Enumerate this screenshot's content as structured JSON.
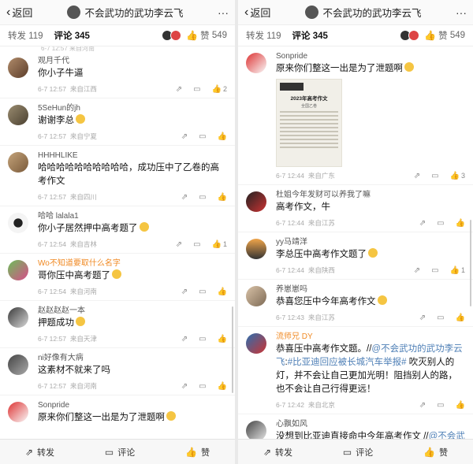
{
  "left": {
    "header": {
      "back_label": "返回",
      "title": "不会武功的武功李云飞",
      "more": "···"
    },
    "tabs": {
      "repost": "转发 119",
      "comment": "评论 345",
      "like_count": "549",
      "like_label": "赞"
    },
    "comments": [
      {
        "name": "观月千代",
        "text": "你小子牛逼",
        "time": "6-7 12:57",
        "source": "来自江西",
        "likes": "2",
        "emoji": false
      },
      {
        "name": "5SeHun的jh",
        "text": "谢谢李总",
        "time": "6-7 12:57",
        "source": "来自宁夏",
        "likes": "",
        "emoji": true
      },
      {
        "name": "HHHHLIKE",
        "text": "哈哈哈哈哈哈哈哈哈哈，成功压中了乙卷的高考作文",
        "time": "6-7 12:57",
        "source": "来自四川",
        "likes": "",
        "emoji": false
      },
      {
        "name": "哈哈 lalala1",
        "text": "你小子居然押中高考题了",
        "time": "6-7 12:54",
        "source": "来自吉林",
        "likes": "1",
        "emoji": true
      },
      {
        "name": "Wo不知道要取什么名字",
        "text": "哥你压中高考题了",
        "time": "6-7 12:54",
        "source": "来自河南",
        "likes": "",
        "emoji": true,
        "orange": true
      },
      {
        "name": "赵赵赵赵一本",
        "text": "押题成功",
        "time": "6-7 12:57",
        "source": "来自天津",
        "likes": "",
        "emoji": true
      },
      {
        "name": "ni好像有大病",
        "text": "这素材不就来了吗",
        "time": "6-7 12:57",
        "source": "来自河南",
        "likes": "",
        "emoji": false
      },
      {
        "name": "Sonpride",
        "text": "原来你们整这一出是为了泄题啊",
        "time": "",
        "source": "",
        "likes": "",
        "emoji": true
      }
    ],
    "bottom": {
      "repost": "转发",
      "comment": "评论",
      "like": "赞"
    }
  },
  "right": {
    "header": {
      "back_label": "返回",
      "title": "不会武功的武功李云飞",
      "more": "···"
    },
    "tabs": {
      "repost": "转发 119",
      "comment": "评论 345",
      "like_count": "549",
      "like_label": "赞"
    },
    "image": {
      "title": "2023年高考作文",
      "subtitle": "全国乙卷"
    },
    "comments": [
      {
        "name": "Sonpride",
        "text": "原来你们整这一出是为了泄题啊",
        "time": "6-7 12:44",
        "source": "来自广东",
        "likes": "3",
        "emoji": true,
        "has_image": true
      },
      {
        "name": "杜姐今年发财可以养我了嘛",
        "text": "高考作文，牛",
        "time": "6-7 12:44",
        "source": "来自江苏",
        "likes": "",
        "emoji": false
      },
      {
        "name": "yy马靖洋",
        "text": "李总压中高考作文题了",
        "time": "6-7 12:44",
        "source": "来自陕西",
        "likes": "1",
        "emoji": true
      },
      {
        "name": "养崽崽吗",
        "text": "恭喜您压中今年高考作文",
        "time": "6-7 12:43",
        "source": "来自江苏",
        "likes": "",
        "emoji": true
      },
      {
        "name": "流师兄 DY",
        "text_before": "恭喜压中高考作文题。//",
        "link1": "@不会武功的武功李云飞",
        "mid1": ":",
        "link2": "#比亚迪回应被长城汽车举报#",
        "text_after": " 吹灭别人的灯，并不会让自己更加光明！阻挡别人的路，也不会让自己行得更远！",
        "time": "6-7 12:42",
        "source": "来自北京",
        "likes": "",
        "orange": true
      },
      {
        "name": "心飘如风",
        "text_before": "没想到比亚迪直接命中今年高考作文 //",
        "link1": "@不会武功",
        "time": "",
        "source": "",
        "likes": ""
      }
    ],
    "bottom": {
      "repost": "转发",
      "comment": "评论",
      "like": "赞"
    }
  }
}
